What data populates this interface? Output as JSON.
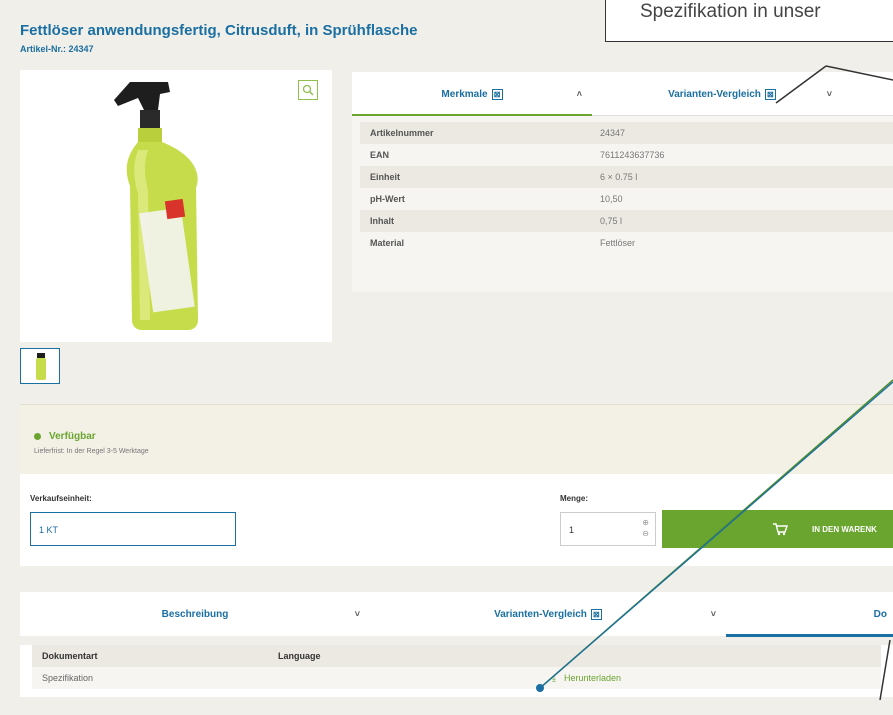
{
  "product": {
    "title": "Fettlöser anwendungsfertig, Citrusduft, in Sprühflasche",
    "article_no": "Artikel-Nr.: 24347"
  },
  "callout": {
    "text": "Spezifikation in unser"
  },
  "top_tabs": [
    {
      "label": "Merkmale",
      "active": true
    },
    {
      "label": "Varianten-Vergleich",
      "active": false
    }
  ],
  "specs": [
    {
      "key": "Artikelnummer",
      "value": "24347"
    },
    {
      "key": "EAN",
      "value": "7611243637736"
    },
    {
      "key": "Einheit",
      "value": "6 × 0.75 l"
    },
    {
      "key": "pH-Wert",
      "value": "10,50"
    },
    {
      "key": "Inhalt",
      "value": "0,75 l"
    },
    {
      "key": "Material",
      "value": "Fettlöser"
    }
  ],
  "availability": {
    "status": "Verfügbar",
    "note": "Lieferfrist: In der Regel 3-5 Werktage"
  },
  "order": {
    "unit_label": "Verkaufseinheit:",
    "unit_value": "1 KT",
    "qty_label": "Menge:",
    "qty_value": "1",
    "cart_label": "IN DEN WARENK"
  },
  "bottom_tabs": [
    {
      "label": "Beschreibung"
    },
    {
      "label": "Varianten-Vergleich"
    },
    {
      "label": "Do"
    }
  ],
  "documents": {
    "headers": [
      "Dokumentart",
      "Language"
    ],
    "rows": [
      {
        "type": "Spezifikation",
        "link": "Herunterladen"
      }
    ]
  },
  "colors": {
    "brand_blue": "#1a6fa3",
    "accent_green": "#6aa52f",
    "bottle_green": "#c7dc4a",
    "annotation_line": "#1a6fa3"
  },
  "icons": {
    "zoom": "magnifier-icon",
    "cart": "cart-icon",
    "download": "download-icon",
    "compare": "compare-icon"
  }
}
